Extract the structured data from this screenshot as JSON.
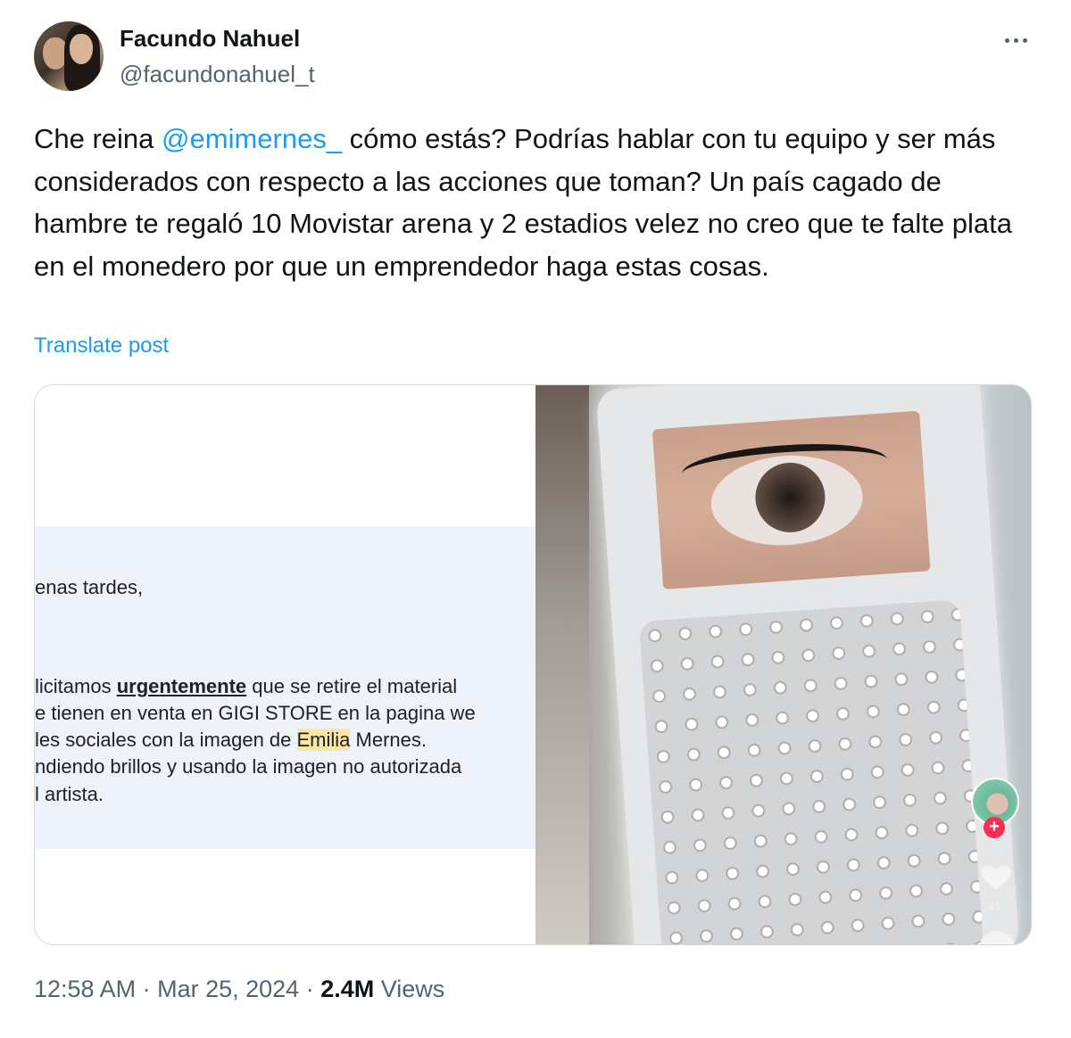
{
  "author": {
    "display_name": "Facundo Nahuel",
    "handle": "@facundonahuel_t"
  },
  "tweet": {
    "text_before_mention": "Che reina ",
    "mention": "@emimernes_",
    "text_after_mention": " cómo estás? Podrías hablar con tu equipo y ser más considerados con respecto a las acciones que toman? Un país cagado de hambre te regaló 10 Movistar arena y 2 estadios velez no creo que te falte plata en el monedero por que un emprendedor haga estas cosas.",
    "translate_label": "Translate post"
  },
  "media": {
    "email": {
      "greeting": "enas tardes,",
      "line1_prefix": "licitamos ",
      "line1_emphasis": "urgentemente",
      "line1_suffix": " que se retire el material",
      "line2": "e tienen en venta en GIGI STORE en la pagina we",
      "line3_prefix": "les sociales  con la imagen de ",
      "line3_highlight": "Emilia",
      "line3_suffix": " Mernes.",
      "line4": "ndiendo brillos y usando la imagen no autorizada",
      "line5": "l artista."
    },
    "video": {
      "plus_badge": "+",
      "like_count": "91",
      "icons": [
        "heart-icon",
        "plus-icon",
        "avatar"
      ]
    }
  },
  "meta": {
    "time": "12:58 AM",
    "separator1": " · ",
    "date": "Mar 25, 2024",
    "separator2": " · ",
    "views_count": "2.4M",
    "views_label": " Views"
  },
  "colors": {
    "link": "#1d9bf0",
    "secondary_text": "#536471",
    "primary_text": "#0f1419",
    "border": "#cfd9de"
  }
}
